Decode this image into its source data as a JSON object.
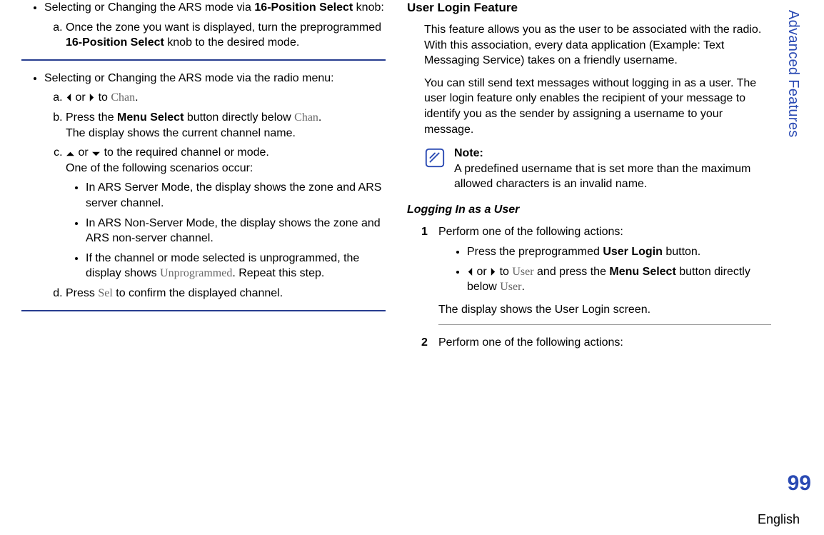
{
  "sidebar": {
    "tab": "Advanced Features"
  },
  "footer": {
    "page": "99",
    "language": "English"
  },
  "left": {
    "bullet1_pre": "Selecting or Changing the ARS mode via ",
    "bullet1_bold": "16-Position Select",
    "bullet1_post": " knob:",
    "b1_a_pre": "Once the zone you want is displayed, turn the preprogrammed ",
    "b1_a_bold": "16-Position Select",
    "b1_a_post": " knob to the desired mode.",
    "bullet2": "Selecting or Changing the ARS mode via the radio menu:",
    "b2_a_or": " or ",
    "b2_a_to": " to ",
    "b2_a_chan": "Chan",
    "b2_a_period": ".",
    "b2_b_pre": "Press the ",
    "b2_b_bold": "Menu Select",
    "b2_b_post": " button directly below ",
    "b2_b_chan": "Chan",
    "b2_b_end": ".",
    "b2_b_line2": "The display shows the current channel name.",
    "b2_c_post": " to the required channel or mode.",
    "b2_c_line2": "One of the following scenarios occur:",
    "sc1": "In ARS Server Mode, the display shows the zone and ARS server channel.",
    "sc2": "In ARS Non-Server Mode, the display shows the zone and ARS non-server channel.",
    "sc3_pre": "If the channel or mode selected is unprogrammed, the display shows ",
    "sc3_menu": "Unprogrammed",
    "sc3_post": ". Repeat this step.",
    "b2_d_pre": "Press ",
    "b2_d_menu": "Sel",
    "b2_d_post": " to confirm the displayed channel."
  },
  "right": {
    "h3": "User Login Feature",
    "p1": "This feature allows you as the user to be associated with the radio. With this association, every data application (Example: Text Messaging Service) takes on a friendly username.",
    "p2": "You can still send text messages without logging in as a user. The user login feature only enables the recipient of your message to identify you as the sender by assigning a username to your message.",
    "note_label": "Note:",
    "note_body": "A predefined username that is set more than the maximum allowed characters is an invalid name.",
    "h4": "Logging In as a User",
    "step1": "Perform one of the following actions:",
    "s1_b1_pre": "Press the preprogrammed ",
    "s1_b1_bold": "User Login",
    "s1_b1_post": " button.",
    "s1_b2_or": " or ",
    "s1_b2_to": " to ",
    "s1_b2_user": "User",
    "s1_b2_mid": " and press the ",
    "s1_b2_bold": "Menu Select",
    "s1_b2_post": " button directly below ",
    "s1_b2_user2": "User",
    "s1_b2_end": ".",
    "s1_result": "The display shows the User Login screen.",
    "step2": "Perform one of the following actions:"
  }
}
